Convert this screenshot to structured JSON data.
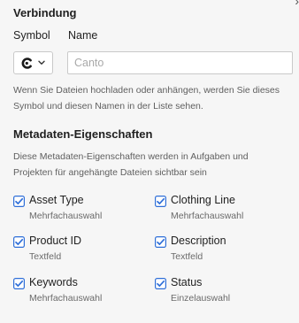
{
  "header": {
    "close_glyph": "›"
  },
  "connection": {
    "title": "Verbindung",
    "symbol_label": "Symbol",
    "name_label": "Name",
    "symbol_icon": "c-logo-icon",
    "name_placeholder": "Canto",
    "name_value": "",
    "help": "Wenn Sie Dateien hochladen oder anhängen, werden Sie dieses Symbol und diesen Namen in der Liste sehen."
  },
  "metadata": {
    "title": "Metadaten-Eigenschaften",
    "help": "Diese Metadaten-Eigenschaften werden in Aufgaben und Projekten für angehängte Dateien sichtbar sein",
    "check_color": "#2f6fd8",
    "properties": [
      {
        "name": "Asset Type",
        "type": "Mehrfachauswahl",
        "checked": true
      },
      {
        "name": "Clothing Line",
        "type": "Mehrfachauswahl",
        "checked": true
      },
      {
        "name": "Product ID",
        "type": "Textfeld",
        "checked": true
      },
      {
        "name": "Description",
        "type": "Textfeld",
        "checked": true
      },
      {
        "name": "Keywords",
        "type": "Mehrfachauswahl",
        "checked": true
      },
      {
        "name": "Status",
        "type": "Einzelauswahl",
        "checked": true
      }
    ]
  }
}
